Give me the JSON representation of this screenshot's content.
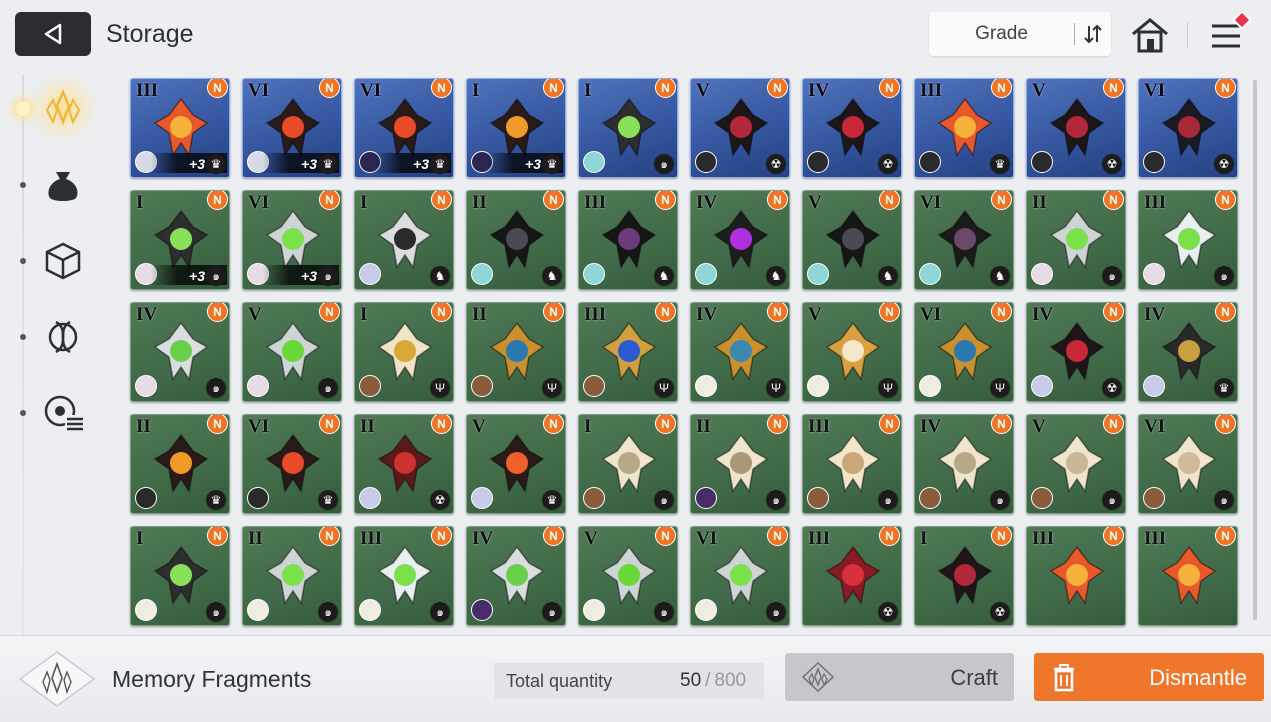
{
  "header": {
    "title": "Storage",
    "sort_label": "Grade"
  },
  "sidebar": {
    "tabs": [
      {
        "icon": "crystal-icon",
        "active": true
      },
      {
        "icon": "pouch-icon",
        "active": false
      },
      {
        "icon": "cube-icon",
        "active": false
      },
      {
        "icon": "dna-icon",
        "active": false
      },
      {
        "icon": "gear-list-icon",
        "active": false
      }
    ]
  },
  "colors": {
    "blue_card": "#3a5ca6",
    "green_card": "#3e6746",
    "badge": "#f07521",
    "dismantle": "#f0762b"
  },
  "items": [
    {
      "grade": "III",
      "color": "blue",
      "badge": "N",
      "plus": "+3",
      "element": "♛",
      "weapon": "fire-orb",
      "avatar": "#d7dbe8"
    },
    {
      "grade": "VI",
      "color": "blue",
      "badge": "N",
      "plus": "+3",
      "element": "♛",
      "weapon": "spiked-claw",
      "avatar": "#d7dbe8"
    },
    {
      "grade": "VI",
      "color": "blue",
      "badge": "N",
      "plus": "+3",
      "element": "♛",
      "weapon": "spiked-claw",
      "avatar": "#2c2650"
    },
    {
      "grade": "I",
      "color": "blue",
      "badge": "N",
      "plus": "+3",
      "element": "♛",
      "weapon": "flame-axe",
      "avatar": "#2c2650"
    },
    {
      "grade": "I",
      "color": "blue",
      "badge": "N",
      "plus": "",
      "element": "๑",
      "weapon": "vial",
      "avatar": "#8ed6d6"
    },
    {
      "grade": "V",
      "color": "blue",
      "badge": "N",
      "plus": "",
      "element": "☢",
      "weapon": "dark-orb",
      "avatar": "#2a2a2a"
    },
    {
      "grade": "IV",
      "color": "blue",
      "badge": "N",
      "plus": "",
      "element": "☢",
      "weapon": "chain-orb",
      "avatar": "#2a2a2a"
    },
    {
      "grade": "III",
      "color": "blue",
      "badge": "N",
      "plus": "",
      "element": "♛",
      "weapon": "fire-orb",
      "avatar": "#2a2a2a"
    },
    {
      "grade": "V",
      "color": "blue",
      "badge": "N",
      "plus": "",
      "element": "☢",
      "weapon": "dark-orb",
      "avatar": "#2a2a2a"
    },
    {
      "grade": "VI",
      "color": "blue",
      "badge": "N",
      "plus": "",
      "element": "☢",
      "weapon": "dark-blade",
      "avatar": "#2a2a2a"
    },
    {
      "grade": "I",
      "color": "green",
      "badge": "N",
      "plus": "+3",
      "element": "๑",
      "weapon": "vial",
      "avatar": "#e6dde4"
    },
    {
      "grade": "VI",
      "color": "green",
      "badge": "N",
      "plus": "+3",
      "element": "๑",
      "weapon": "syringe",
      "avatar": "#e6dde4"
    },
    {
      "grade": "I",
      "color": "green",
      "badge": "N",
      "plus": "",
      "element": "♞",
      "weapon": "crossed-blades",
      "avatar": "#c8cce8"
    },
    {
      "grade": "II",
      "color": "green",
      "badge": "N",
      "plus": "",
      "element": "♞",
      "weapon": "black-wing",
      "avatar": "#8ed6d6"
    },
    {
      "grade": "III",
      "color": "green",
      "badge": "N",
      "plus": "",
      "element": "♞",
      "weapon": "dark-wings",
      "avatar": "#8ed6d6"
    },
    {
      "grade": "IV",
      "color": "green",
      "badge": "N",
      "plus": "",
      "element": "♞",
      "weapon": "chain-wing",
      "avatar": "#8ed6d6"
    },
    {
      "grade": "V",
      "color": "green",
      "badge": "N",
      "plus": "",
      "element": "♞",
      "weapon": "black-wing",
      "avatar": "#8ed6d6"
    },
    {
      "grade": "VI",
      "color": "green",
      "badge": "N",
      "plus": "",
      "element": "♞",
      "weapon": "feather",
      "avatar": "#8ed6d6"
    },
    {
      "grade": "II",
      "color": "green",
      "badge": "N",
      "plus": "",
      "element": "๑",
      "weapon": "syringe",
      "avatar": "#e6dde4"
    },
    {
      "grade": "III",
      "color": "green",
      "badge": "N",
      "plus": "",
      "element": "๑",
      "weapon": "potion",
      "avatar": "#e6dde4"
    },
    {
      "grade": "IV",
      "color": "green",
      "badge": "N",
      "plus": "",
      "element": "๑",
      "weapon": "chain-vial",
      "avatar": "#e6dde4"
    },
    {
      "grade": "V",
      "color": "green",
      "badge": "N",
      "plus": "",
      "element": "๑",
      "weapon": "beaker",
      "avatar": "#e6dde4"
    },
    {
      "grade": "I",
      "color": "green",
      "badge": "N",
      "plus": "",
      "element": "Ψ",
      "weapon": "golden-shield",
      "avatar": "#8a5a3c"
    },
    {
      "grade": "II",
      "color": "green",
      "badge": "N",
      "plus": "",
      "element": "Ψ",
      "weapon": "golden-staff",
      "avatar": "#8a5a3c"
    },
    {
      "grade": "III",
      "color": "green",
      "badge": "N",
      "plus": "",
      "element": "Ψ",
      "weapon": "trident-orb",
      "avatar": "#8a5a3c"
    },
    {
      "grade": "IV",
      "color": "green",
      "badge": "N",
      "plus": "",
      "element": "Ψ",
      "weapon": "trident",
      "avatar": "#f1ede4"
    },
    {
      "grade": "V",
      "color": "green",
      "badge": "N",
      "plus": "",
      "element": "Ψ",
      "weapon": "golden-lantern",
      "avatar": "#f1ede4"
    },
    {
      "grade": "VI",
      "color": "green",
      "badge": "N",
      "plus": "",
      "element": "Ψ",
      "weapon": "golden-staff",
      "avatar": "#f1ede4"
    },
    {
      "grade": "IV",
      "color": "green",
      "badge": "N",
      "plus": "",
      "element": "☢",
      "weapon": "chain-orb",
      "avatar": "#c8cce8"
    },
    {
      "grade": "IV",
      "color": "green",
      "badge": "N",
      "plus": "",
      "element": "♛",
      "weapon": "necklace",
      "avatar": "#c8cce8"
    },
    {
      "grade": "II",
      "color": "green",
      "badge": "N",
      "plus": "",
      "element": "♛",
      "weapon": "flame-axe",
      "avatar": "#2a2a2a"
    },
    {
      "grade": "VI",
      "color": "green",
      "badge": "N",
      "plus": "",
      "element": "♛",
      "weapon": "spiked-claw",
      "avatar": "#2a2a2a"
    },
    {
      "grade": "II",
      "color": "green",
      "badge": "N",
      "plus": "",
      "element": "☢",
      "weapon": "red-wreath",
      "avatar": "#c8cce8"
    },
    {
      "grade": "V",
      "color": "green",
      "badge": "N",
      "plus": "",
      "element": "♛",
      "weapon": "flame-lantern",
      "avatar": "#c8cce8"
    },
    {
      "grade": "I",
      "color": "green",
      "badge": "N",
      "plus": "",
      "element": "๑",
      "weapon": "ivory-staff",
      "avatar": "#8a5a3c"
    },
    {
      "grade": "II",
      "color": "green",
      "badge": "N",
      "plus": "",
      "element": "๑",
      "weapon": "ivory-key",
      "avatar": "#4a2c6a"
    },
    {
      "grade": "III",
      "color": "green",
      "badge": "N",
      "plus": "",
      "element": "๑",
      "weapon": "ivory-shell",
      "avatar": "#8a5a3c"
    },
    {
      "grade": "IV",
      "color": "green",
      "badge": "N",
      "plus": "",
      "element": "๑",
      "weapon": "ivory-necklace",
      "avatar": "#8a5a3c"
    },
    {
      "grade": "V",
      "color": "green",
      "badge": "N",
      "plus": "",
      "element": "๑",
      "weapon": "ivory-goblet",
      "avatar": "#8a5a3c"
    },
    {
      "grade": "VI",
      "color": "green",
      "badge": "N",
      "plus": "",
      "element": "๑",
      "weapon": "ivory-feathers",
      "avatar": "#8a5a3c"
    },
    {
      "grade": "I",
      "color": "green",
      "badge": "N",
      "plus": "",
      "element": "๑",
      "weapon": "vial",
      "avatar": "#f1ede4"
    },
    {
      "grade": "II",
      "color": "green",
      "badge": "N",
      "plus": "",
      "element": "๑",
      "weapon": "syringe",
      "avatar": "#f1ede4"
    },
    {
      "grade": "III",
      "color": "green",
      "badge": "N",
      "plus": "",
      "element": "๑",
      "weapon": "potion",
      "avatar": "#f1ede4"
    },
    {
      "grade": "IV",
      "color": "green",
      "badge": "N",
      "plus": "",
      "element": "๑",
      "weapon": "chain-vial",
      "avatar": "#4a2c6a"
    },
    {
      "grade": "V",
      "color": "green",
      "badge": "N",
      "plus": "",
      "element": "๑",
      "weapon": "beaker",
      "avatar": "#f1ede4"
    },
    {
      "grade": "VI",
      "color": "green",
      "badge": "N",
      "plus": "",
      "element": "๑",
      "weapon": "syringe",
      "avatar": "#f1ede4"
    },
    {
      "grade": "III",
      "color": "green",
      "badge": "N",
      "plus": "",
      "element": "☢",
      "weapon": "red-skull",
      "avatar": ""
    },
    {
      "grade": "I",
      "color": "green",
      "badge": "N",
      "plus": "",
      "element": "☢",
      "weapon": "dark-claw",
      "avatar": ""
    },
    {
      "grade": "III",
      "color": "green",
      "badge": "N",
      "plus": "",
      "element": "",
      "weapon": "fire-orb",
      "avatar": ""
    },
    {
      "grade": "III",
      "color": "green",
      "badge": "N",
      "plus": "",
      "element": "",
      "weapon": "fire-orb",
      "avatar": ""
    }
  ],
  "footer": {
    "category_label": "Memory Fragments",
    "total_label": "Total quantity",
    "total_current": "50",
    "total_separator": "/",
    "total_max": "800",
    "craft_label": "Craft",
    "dismantle_label": "Dismantle"
  }
}
